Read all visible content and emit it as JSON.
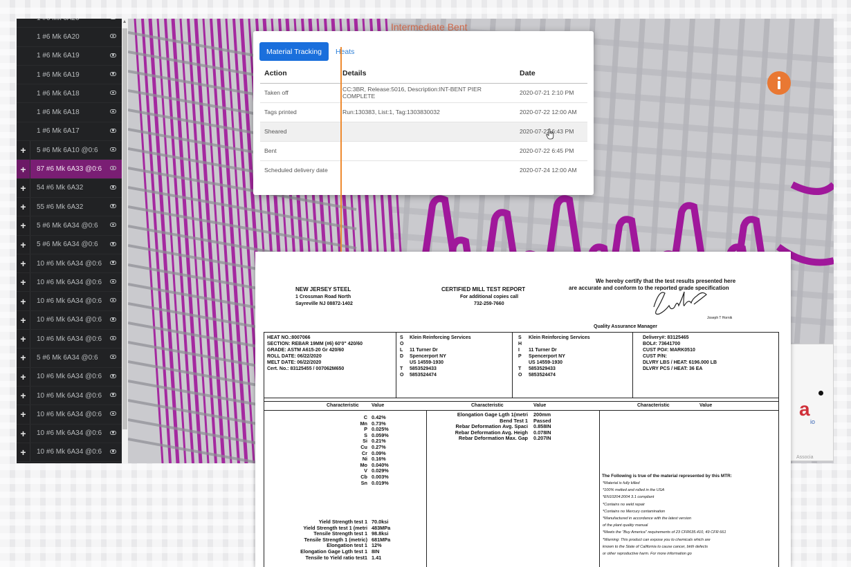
{
  "sidebar": {
    "items": [
      {
        "label": "1 #6 Mk 6A20",
        "expandable": false,
        "selected": false
      },
      {
        "label": "1 #6 Mk 6A20",
        "expandable": false,
        "selected": false
      },
      {
        "label": "1 #6 Mk 6A19",
        "expandable": false,
        "selected": false
      },
      {
        "label": "1 #6 Mk 6A19",
        "expandable": false,
        "selected": false
      },
      {
        "label": "1 #6 Mk 6A18",
        "expandable": false,
        "selected": false
      },
      {
        "label": "1 #6 Mk 6A18",
        "expandable": false,
        "selected": false
      },
      {
        "label": "1 #6 Mk 6A17",
        "expandable": false,
        "selected": false
      },
      {
        "label": "5 #6 Mk 6A10 @0:6",
        "expandable": true,
        "selected": false
      },
      {
        "label": "87 #6 Mk 6A33 @0:6",
        "expandable": true,
        "selected": true
      },
      {
        "label": "54 #6 Mk 6A32",
        "expandable": true,
        "selected": false
      },
      {
        "label": "55 #6 Mk 6A32",
        "expandable": true,
        "selected": false
      },
      {
        "label": "5 #6 Mk 6A34 @0:6",
        "expandable": true,
        "selected": false
      },
      {
        "label": "5 #6 Mk 6A34 @0:6",
        "expandable": true,
        "selected": false
      },
      {
        "label": "10 #6 Mk 6A34 @0:6",
        "expandable": true,
        "selected": false
      },
      {
        "label": "10 #6 Mk 6A34 @0:6",
        "expandable": true,
        "selected": false
      },
      {
        "label": "10 #6 Mk 6A34 @0:6",
        "expandable": true,
        "selected": false
      },
      {
        "label": "10 #6 Mk 6A34 @0:6",
        "expandable": true,
        "selected": false
      },
      {
        "label": "10 #6 Mk 6A34 @0:6",
        "expandable": true,
        "selected": false
      },
      {
        "label": "5 #6 Mk 6A34 @0:6",
        "expandable": true,
        "selected": false
      },
      {
        "label": "10 #6 Mk 6A34 @0:6",
        "expandable": true,
        "selected": false
      },
      {
        "label": "10 #6 Mk 6A34 @0:6",
        "expandable": true,
        "selected": false
      },
      {
        "label": "10 #6 Mk 6A34 @0:6",
        "expandable": true,
        "selected": false
      },
      {
        "label": "10 #6 Mk 6A34 @0:6",
        "expandable": true,
        "selected": false
      },
      {
        "label": "10 #6 Mk 6A34 @0:6",
        "expandable": true,
        "selected": false
      }
    ]
  },
  "viewport": {
    "title": "Intermediate Bent",
    "logo_letter": "a",
    "logo_sub": "io",
    "logo_foot": "Associa",
    "colors": {
      "rebar": "#a0189b",
      "grid_bar": "#bcbcc1",
      "background": "#cacace"
    }
  },
  "popup": {
    "tabs": [
      {
        "label": "Material Tracking",
        "active": true
      },
      {
        "label": "Heats",
        "active": false
      }
    ],
    "columns": [
      "Action",
      "Details",
      "Date"
    ],
    "rows": [
      {
        "action": "Taken off",
        "details": "CC:3BR, Release:5016, Description:INT-BENT PIER COMPLETE",
        "date": "2020-07-21 2:10 PM"
      },
      {
        "action": "Tags printed",
        "details": "Run:130383, List:1, Tag:1303830032",
        "date": "2020-07-22 12:00 AM"
      },
      {
        "action": "Sheared",
        "details": "",
        "date": "2020-07-22 6:43 PM",
        "hovered": true
      },
      {
        "action": "Bent",
        "details": "",
        "date": "2020-07-22 6:45 PM"
      },
      {
        "action": "Scheduled delivery date",
        "details": "",
        "date": "2020-07-24 12:00 AM"
      }
    ]
  },
  "report": {
    "company": [
      "NEW JERSEY STEEL",
      "1 Crossman Road North",
      "Sayreville NJ 08872-1402"
    ],
    "title": "CERTIFIED MILL TEST REPORT",
    "copies": [
      "For additional copies call",
      "732-259-7660"
    ],
    "certify": [
      "We hereby certify that the test results presented here",
      "are accurate and conform to the reported grade specification"
    ],
    "signer_name": "Joseph T Hornik",
    "signer_title": "Quality Assurance Manager",
    "heat_info": [
      "HEAT NO.:8007066",
      "SECTION: REBAR 19MM (#6) 60'0\" 420/60",
      "GRADE: ASTM A615-20 Gr 420/60",
      "ROLL DATE: 06/22/2020",
      "MELT DATE: 06/22/2020",
      "Cert. No.: 83125455 / 007062M650"
    ],
    "sold_to_label": [
      "S",
      "O",
      "L",
      "D",
      "",
      "T",
      "O"
    ],
    "sold_to": [
      "Klein Reinforcing Services",
      "",
      "11 Turner Dr",
      "Spencerport  NY",
      "US  14559-1930",
      "5853529433",
      "5853524474"
    ],
    "ship_to_label": [
      "S",
      "H",
      "I",
      "P",
      "",
      "T",
      "O"
    ],
    "ship_to": [
      "Klein Reinforcing Services",
      "",
      "11 Turner Dr",
      "Spencerport  NY",
      "US  14559-1930",
      "5853529433",
      "5853524474"
    ],
    "delivery": [
      "Delivery#: 83125465",
      "BOL#: 73641700",
      "CUST PO#: MARK0510",
      "CUST P/N:",
      "DLVRY LBS / HEAT: 6196.000  LB",
      "DLVRY PCS / HEAT: 36  EA"
    ],
    "col_headers": [
      "Characteristic",
      "Value",
      "Characteristic",
      "Value",
      "Characteristic",
      "Value"
    ],
    "chemistry": [
      {
        "name": "C",
        "value": "0.42%"
      },
      {
        "name": "Mn",
        "value": "0.73%"
      },
      {
        "name": "P",
        "value": "0.025%"
      },
      {
        "name": "S",
        "value": "0.059%"
      },
      {
        "name": "Si",
        "value": "0.21%"
      },
      {
        "name": "Cu",
        "value": "0.27%"
      },
      {
        "name": "Cr",
        "value": "0.09%"
      },
      {
        "name": "Ni",
        "value": "0.16%"
      },
      {
        "name": "Mo",
        "value": "0.040%"
      },
      {
        "name": "V",
        "value": "0.029%"
      },
      {
        "name": "Cb",
        "value": "0.003%"
      },
      {
        "name": "Sn",
        "value": "0.019%"
      }
    ],
    "mechanical": [
      {
        "name": "Yield Strength test 1",
        "value": "70.0ksi"
      },
      {
        "name": "Yield Strength test 1 (metri",
        "value": "483MPa"
      },
      {
        "name": "Tensile Strength test 1",
        "value": "98.8ksi"
      },
      {
        "name": "Tensile Strength 1 (metric)",
        "value": "681MPa"
      },
      {
        "name": "Elongation test 1",
        "value": "12%"
      },
      {
        "name": "Elongation Gage Lgth test 1",
        "value": "8IN"
      },
      {
        "name": "Tensile to Yield ratio test1",
        "value": "1.41"
      }
    ],
    "middle": [
      {
        "name": "Elongation Gage Lgth 1(metri",
        "value": "200mm"
      },
      {
        "name": "Bend Test 1",
        "value": "Passed"
      },
      {
        "name": "Rebar Deformation Avg. Spaci",
        "value": "0.858IN"
      },
      {
        "name": "Rebar Deformation Avg. Heigh",
        "value": "0.078IN"
      },
      {
        "name": "Rebar Deformation Max. Gap",
        "value": "0.207IN"
      }
    ],
    "notes_title": "The Following is true of the material represented by this MTR:",
    "notes": [
      "*Material is fully killed",
      "*100% melted and rolled in the USA",
      "*EN10204:2004 3.1 compliant",
      "*Contains no weld repair",
      "*Contains no Mercury contamination",
      "*Manufactured in accordance with the latest version",
      "  of the plant quality manual",
      "*Meets the \"Buy America\" requirements of 23 CFR635.410, 49 CFR 661",
      "*Warning:  This product can expose you to chemicals which are",
      "  known to the State of California to cause cancer, birth defects",
      "  or other reproductive harm. For more information go"
    ]
  }
}
